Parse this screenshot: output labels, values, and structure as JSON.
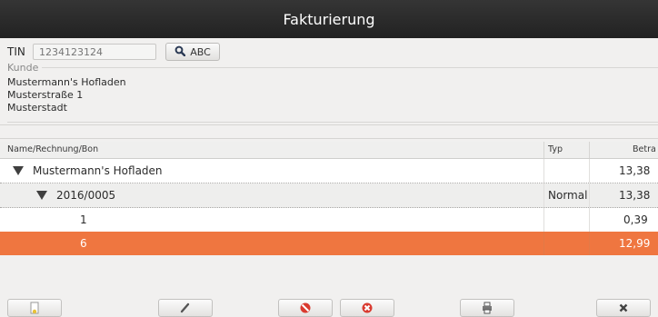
{
  "window": {
    "title": "Fakturierung"
  },
  "search": {
    "tin_label": "TIN",
    "tin_placeholder": "1234123124",
    "abc_button_label": "ABC"
  },
  "customer": {
    "legend": "Kunde",
    "lines": [
      "Mustermann's Hofladen",
      "Musterstraße 1",
      "Musterstadt"
    ]
  },
  "table": {
    "columns": [
      "Name/Rechnung/Bon",
      "Typ",
      "Betra"
    ],
    "rows": [
      {
        "name": "Mustermann's Hofladen",
        "typ": "",
        "betrag": "13,38",
        "level": 0,
        "expanded": true,
        "selected": false
      },
      {
        "name": "2016/0005",
        "typ": "Normal",
        "betrag": "13,38",
        "level": 1,
        "expanded": true,
        "selected": false
      },
      {
        "name": "1",
        "typ": "",
        "betrag": "0,39",
        "level": 2,
        "expanded": false,
        "selected": false
      },
      {
        "name": "6",
        "typ": "",
        "betrag": "12,99",
        "level": 2,
        "expanded": false,
        "selected": true
      }
    ]
  },
  "toolbar": {
    "buttons": [
      {
        "icon": "document-new-icon"
      },
      {
        "icon": "pencil-icon"
      },
      {
        "icon": "cancel-icon"
      },
      {
        "icon": "delete-icon"
      },
      {
        "icon": "print-icon"
      },
      {
        "icon": "close-icon"
      }
    ]
  },
  "colors": {
    "titlebar": "#2b2b2b",
    "selection": "#ef7640",
    "background": "#f1f0ef"
  }
}
